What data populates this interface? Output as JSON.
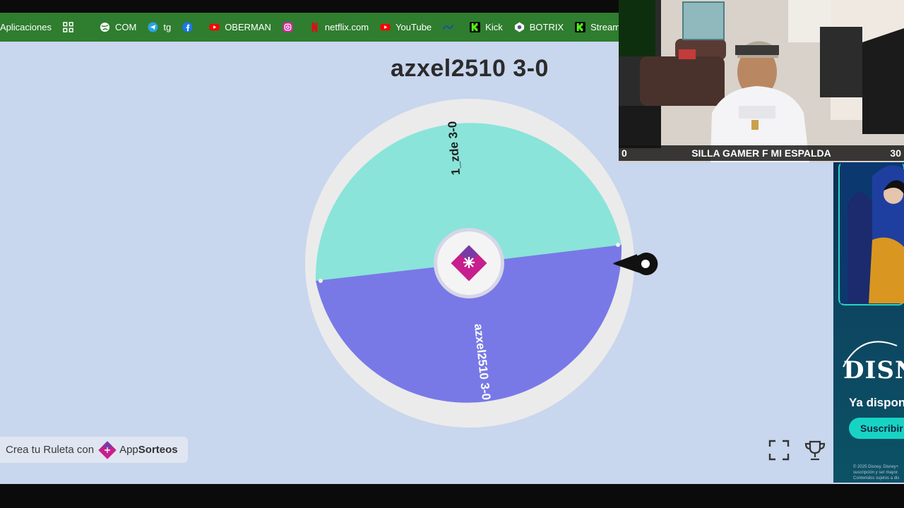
{
  "bookmarks": [
    {
      "label": "Aplicaciones",
      "icon": "none"
    },
    {
      "label": "",
      "icon": "apps-grid-icon"
    },
    {
      "label": "COM",
      "icon": "globe-icon"
    },
    {
      "label": "tg",
      "icon": "telegram-icon"
    },
    {
      "label": "",
      "icon": "facebook-icon"
    },
    {
      "label": "OBERMAN",
      "icon": "youtube-icon"
    },
    {
      "label": "",
      "icon": "instagram-icon"
    },
    {
      "label": "netflix.com",
      "icon": "netflix-icon"
    },
    {
      "label": "YouTube",
      "icon": "youtube-icon"
    },
    {
      "label": "",
      "icon": "fifa-icon"
    },
    {
      "label": "Kick",
      "icon": "kick-icon"
    },
    {
      "label": "BOTRIX",
      "icon": "botrix-icon"
    },
    {
      "label": "Stream - Kick",
      "icon": "kick-icon"
    }
  ],
  "wheel": {
    "title": "azxel2510 3-0",
    "segments": [
      {
        "label": "1_zde 3-0",
        "color": "#8ae4d9"
      },
      {
        "label": "azxel2510  3-0",
        "color": "#7879e6"
      }
    ],
    "center_icon": "appsorteos-logo-icon"
  },
  "footer": {
    "prefix": "Crea tu Ruleta con",
    "brand_light": "App",
    "brand_bold": "Sorteos"
  },
  "controls": {
    "fullscreen_icon": "fullscreen-icon",
    "trophy_icon": "trophy-icon"
  },
  "webcam": {
    "left_count": "0",
    "caption": "SILLA GAMER F MI ESPALDA",
    "right_count": "30"
  },
  "ad": {
    "brand": "DISNEY",
    "headline": "Ya dispon",
    "cta": "Suscribir",
    "legal": "© 2025 Disney. Disney+ suscripción y ser mayor. Contenidos sujetos a dis"
  },
  "colors": {
    "accent_pink": "#c71f8d",
    "accent_purple": "#7a3aa5",
    "background": "#c8d6ee",
    "bookmark_bar": "#2f7d2f"
  }
}
